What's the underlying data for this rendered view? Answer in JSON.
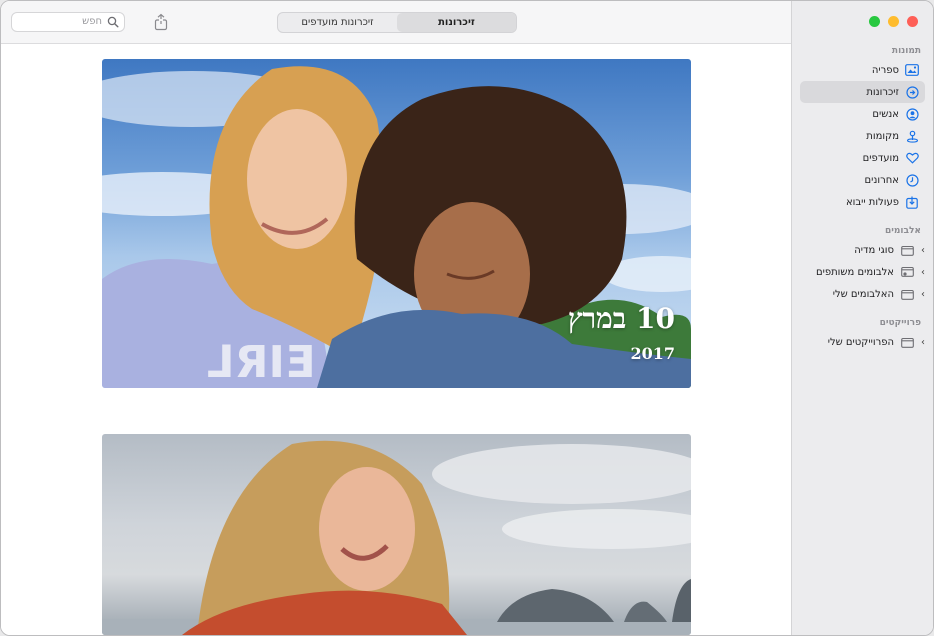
{
  "toolbar": {
    "search_placeholder": "חפש",
    "tabs": [
      {
        "label": "זיכרונות",
        "active": true
      },
      {
        "label": "זיכרונות מועדפים",
        "active": false
      }
    ]
  },
  "memories": [
    {
      "title": "10 במרץ",
      "year": "2017"
    }
  ],
  "sidebar": {
    "sections": {
      "photos": "תמונות",
      "albums": "אלבומים",
      "projects": "פרוייקטים"
    },
    "photos_items": [
      {
        "label": "ספריה",
        "icon": "library-icon"
      },
      {
        "label": "זיכרונות",
        "icon": "memories-icon",
        "selected": true
      },
      {
        "label": "אנשים",
        "icon": "people-icon"
      },
      {
        "label": "מקומות",
        "icon": "places-icon"
      },
      {
        "label": "מועדפים",
        "icon": "heart-icon"
      },
      {
        "label": "אחרונים",
        "icon": "clock-icon"
      },
      {
        "label": "פעולות ייבוא",
        "icon": "import-icon"
      }
    ],
    "album_items": [
      {
        "label": "סוגי מדיה",
        "icon": "folder-icon"
      },
      {
        "label": "אלבומים משותפים",
        "icon": "shared-folder-icon"
      },
      {
        "label": "האלבומים שלי",
        "icon": "folder-icon"
      }
    ],
    "project_items": [
      {
        "label": "הפרוייקטים שלי",
        "icon": "folder-icon"
      }
    ]
  },
  "colors": {
    "accent": "#1a73e8",
    "close": "#fe5f57",
    "minimize": "#febc2e",
    "zoom": "#28c840"
  }
}
